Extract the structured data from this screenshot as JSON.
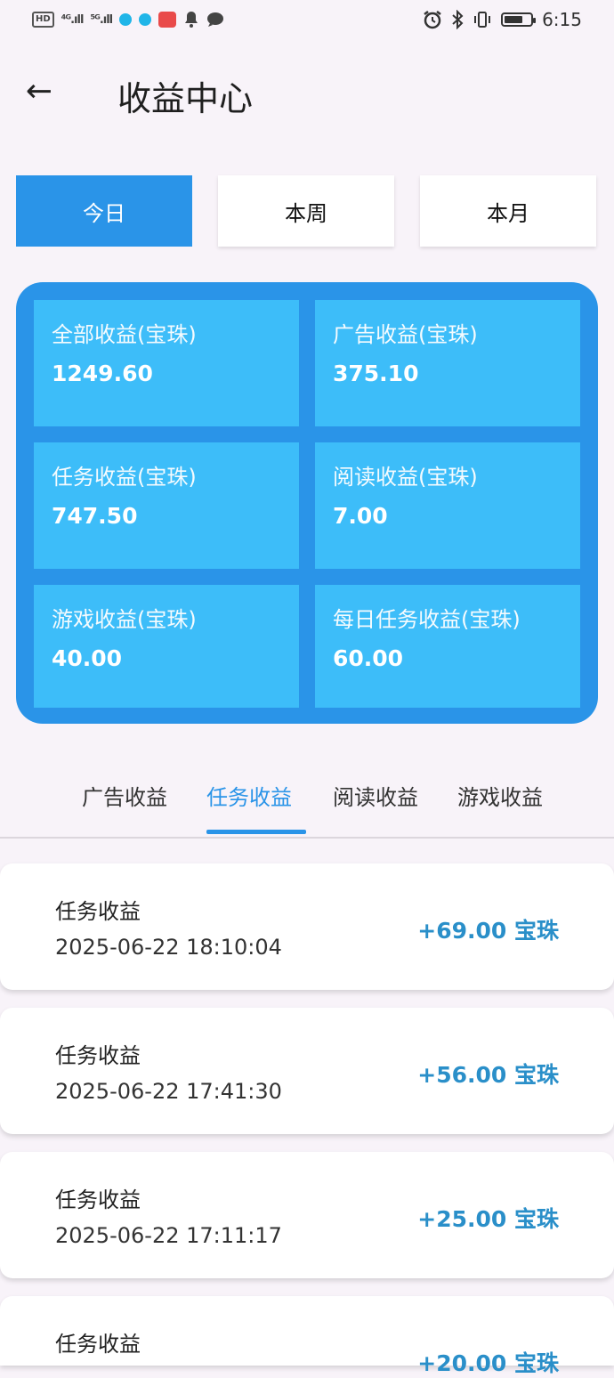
{
  "status_bar": {
    "hd": "HD",
    "signal1": "⁴ᴳ.ıll",
    "signal2": "⁵ᴳ.ıll",
    "icons_left": [
      "hd-icon",
      "signal-icon",
      "signal-icon",
      "app-dot-icon",
      "app-dot-icon",
      "app-red-icon",
      "bell-icon",
      "chat-icon"
    ],
    "icons_right": [
      "alarm-icon",
      "bluetooth-icon",
      "vibrate-icon",
      "battery-icon"
    ],
    "battery_level": 0.7,
    "time": "6:15"
  },
  "header": {
    "back": "←",
    "title": "收益中心"
  },
  "period_tabs": [
    {
      "label": "今日",
      "active": true
    },
    {
      "label": "本周",
      "active": false
    },
    {
      "label": "本月",
      "active": false
    }
  ],
  "stats": [
    {
      "label": "全部收益(宝珠)",
      "value": "1249.60"
    },
    {
      "label": "广告收益(宝珠)",
      "value": "375.10"
    },
    {
      "label": "任务收益(宝珠)",
      "value": "747.50"
    },
    {
      "label": "阅读收益(宝珠)",
      "value": "7.00"
    },
    {
      "label": "游戏收益(宝珠)",
      "value": "40.00"
    },
    {
      "label": "每日任务收益(宝珠)",
      "value": "60.00"
    }
  ],
  "category_tabs": [
    {
      "label": "广告收益",
      "active": false
    },
    {
      "label": "任务收益",
      "active": true
    },
    {
      "label": "阅读收益",
      "active": false
    },
    {
      "label": "游戏收益",
      "active": false
    }
  ],
  "records": [
    {
      "title": "任务收益",
      "time": "2025-06-22 18:10:04",
      "amount": "+69.00 宝珠"
    },
    {
      "title": "任务收益",
      "time": "2025-06-22 17:41:30",
      "amount": "+56.00 宝珠"
    },
    {
      "title": "任务收益",
      "time": "2025-06-22 17:11:17",
      "amount": "+25.00 宝珠"
    },
    {
      "title": "任务收益",
      "time": "",
      "amount": "+20.00 宝珠"
    }
  ],
  "colors": {
    "accent": "#2a94e8",
    "tile": "#3dbdf9",
    "amount": "#2a8fc9",
    "background": "#f8f3f9"
  }
}
